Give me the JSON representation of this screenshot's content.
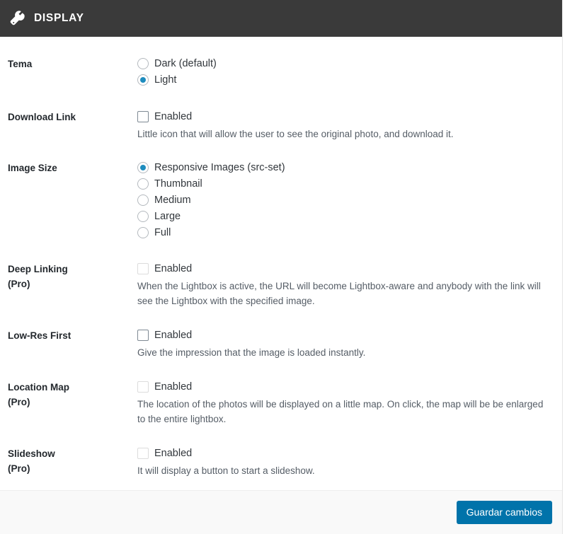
{
  "header": {
    "title": "DISPLAY",
    "icon": "wrench-icon",
    "background": "#3a3a3a"
  },
  "fields": [
    {
      "id": "tema",
      "label": "Tema",
      "sub_label": "",
      "type": "radio",
      "options": [
        {
          "label": "Dark (default)",
          "checked": false
        },
        {
          "label": "Light",
          "checked": true
        }
      ]
    },
    {
      "id": "download-link",
      "label": "Download Link",
      "sub_label": "",
      "type": "checkbox",
      "checkbox_label": "Enabled",
      "checked": false,
      "disabled": false,
      "description": "Little icon that will allow the user to see the original photo, and download it."
    },
    {
      "id": "image-size",
      "label": "Image Size",
      "sub_label": "",
      "type": "radio",
      "options": [
        {
          "label": "Responsive Images (src-set)",
          "checked": true
        },
        {
          "label": "Thumbnail",
          "checked": false
        },
        {
          "label": "Medium",
          "checked": false
        },
        {
          "label": "Large",
          "checked": false
        },
        {
          "label": "Full",
          "checked": false
        }
      ]
    },
    {
      "id": "deep-linking",
      "label": "Deep Linking",
      "sub_label": "(Pro)",
      "type": "checkbox",
      "checkbox_label": "Enabled",
      "checked": false,
      "disabled": true,
      "description": "When the Lightbox is active, the URL will become Lightbox-aware and anybody with the link will see the Lightbox with the specified image."
    },
    {
      "id": "low-res-first",
      "label": "Low-Res First",
      "sub_label": "",
      "type": "checkbox",
      "checkbox_label": "Enabled",
      "checked": false,
      "disabled": false,
      "description": "Give the impression that the image is loaded instantly."
    },
    {
      "id": "location-map",
      "label": "Location Map",
      "sub_label": "(Pro)",
      "type": "checkbox",
      "checkbox_label": "Enabled",
      "checked": false,
      "disabled": true,
      "description": "The location of the photos will be displayed on a little map. On click, the map will be be enlarged to the entire lightbox."
    },
    {
      "id": "slideshow",
      "label": "Slideshow",
      "sub_label": "(Pro)",
      "type": "checkbox",
      "checkbox_label": "Enabled",
      "checked": false,
      "disabled": true,
      "description": "It will display a button to start a slideshow."
    }
  ],
  "footer": {
    "save_label": "Guardar cambios",
    "accent_color": "#0073aa"
  }
}
